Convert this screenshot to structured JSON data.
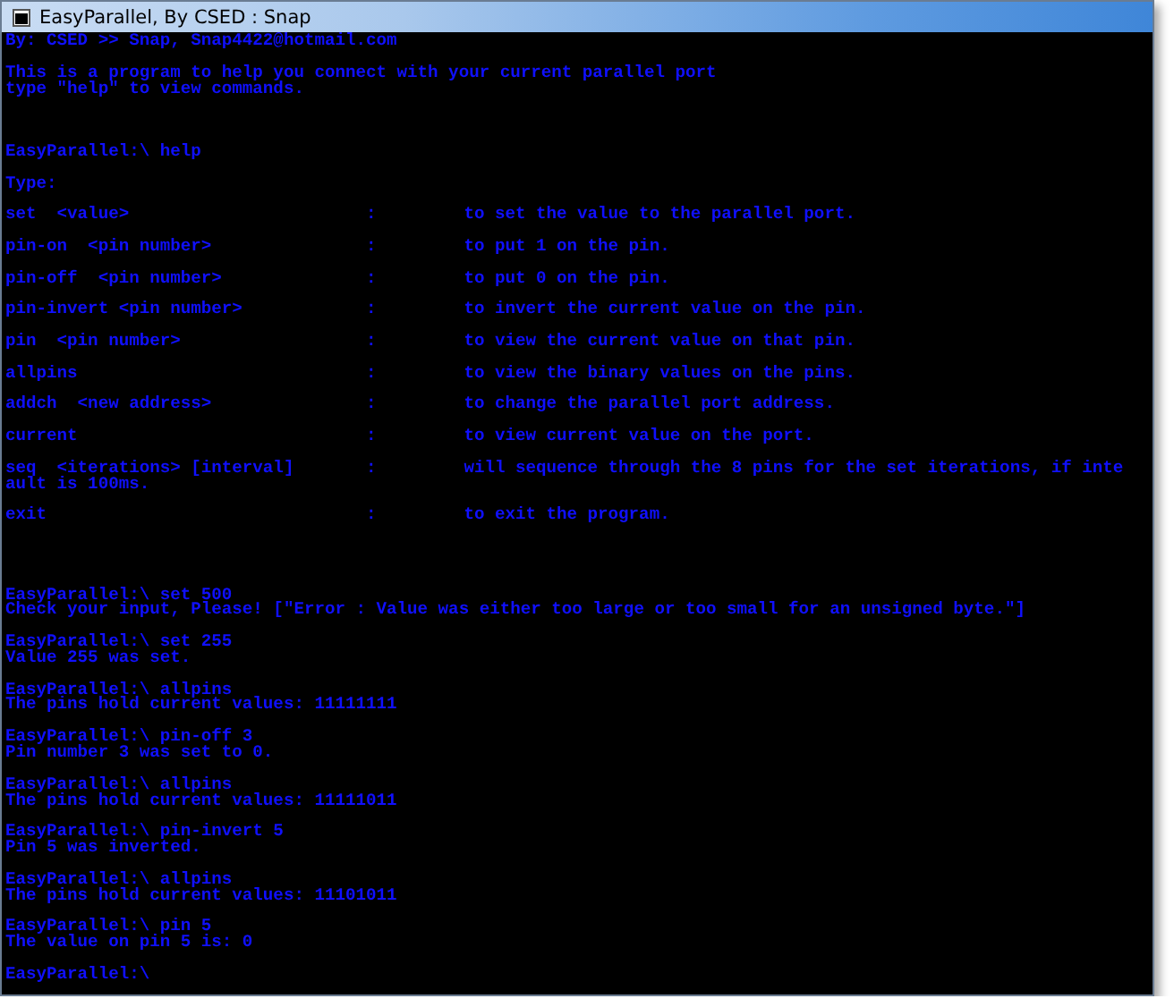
{
  "window": {
    "title": "EasyParallel, By CSED : Snap"
  },
  "console": [
    {
      "kind": "text",
      "text": "By: CSED >> Snap, Snap4422@hotmail.com"
    },
    {
      "kind": "gap"
    },
    {
      "kind": "text",
      "text": "This is a program to help you connect with your current parallel port"
    },
    {
      "kind": "text",
      "text": "type \"help\" to view commands."
    },
    {
      "kind": "gap"
    },
    {
      "kind": "gap"
    },
    {
      "kind": "gap"
    },
    {
      "kind": "text",
      "text": "EasyParallel:\\ help"
    },
    {
      "kind": "gap"
    },
    {
      "kind": "text",
      "text": "Type:"
    },
    {
      "kind": "gap"
    },
    {
      "kind": "help",
      "command": "set  <value>",
      "separator": ":",
      "description": "to set the value to the parallel port."
    },
    {
      "kind": "gap"
    },
    {
      "kind": "help",
      "command": "pin-on  <pin number>",
      "separator": ":",
      "description": "to put 1 on the pin."
    },
    {
      "kind": "gap"
    },
    {
      "kind": "help",
      "command": "pin-off  <pin number>",
      "separator": ":",
      "description": "to put 0 on the pin."
    },
    {
      "kind": "gap"
    },
    {
      "kind": "help",
      "command": "pin-invert <pin number>",
      "separator": ":",
      "description": "to invert the current value on the pin."
    },
    {
      "kind": "gap"
    },
    {
      "kind": "help",
      "command": "pin  <pin number>",
      "separator": ":",
      "description": "to view the current value on that pin."
    },
    {
      "kind": "gap"
    },
    {
      "kind": "help",
      "command": "allpins",
      "separator": ":",
      "description": "to view the binary values on the pins."
    },
    {
      "kind": "gap"
    },
    {
      "kind": "help",
      "command": "addch  <new address>",
      "separator": ":",
      "description": "to change the parallel port address."
    },
    {
      "kind": "gap"
    },
    {
      "kind": "help",
      "command": "current",
      "separator": ":",
      "description": "to view current value on the port."
    },
    {
      "kind": "gap"
    },
    {
      "kind": "help",
      "command": "seq  <iterations> [interval]",
      "separator": ":",
      "description": "will sequence through the 8 pins for the set iterations, if inte"
    },
    {
      "kind": "text",
      "text": "ault is 100ms."
    },
    {
      "kind": "gap"
    },
    {
      "kind": "help",
      "command": "exit",
      "separator": ":",
      "description": "to exit the program."
    },
    {
      "kind": "gap"
    },
    {
      "kind": "gap"
    },
    {
      "kind": "gap"
    },
    {
      "kind": "gap"
    },
    {
      "kind": "text",
      "text": "EasyParallel:\\ set 500"
    },
    {
      "kind": "text",
      "text": "Check your input, Please! [\"Error : Value was either too large or too small for an unsigned byte.\"]"
    },
    {
      "kind": "gap"
    },
    {
      "kind": "text",
      "text": "EasyParallel:\\ set 255"
    },
    {
      "kind": "text",
      "text": "Value 255 was set."
    },
    {
      "kind": "gap"
    },
    {
      "kind": "text",
      "text": "EasyParallel:\\ allpins"
    },
    {
      "kind": "text",
      "text": "The pins hold current values: 11111111"
    },
    {
      "kind": "gap"
    },
    {
      "kind": "text",
      "text": "EasyParallel:\\ pin-off 3"
    },
    {
      "kind": "text",
      "text": "Pin number 3 was set to 0."
    },
    {
      "kind": "gap"
    },
    {
      "kind": "text",
      "text": "EasyParallel:\\ allpins"
    },
    {
      "kind": "text",
      "text": "The pins hold current values: 11111011"
    },
    {
      "kind": "gap"
    },
    {
      "kind": "text",
      "text": "EasyParallel:\\ pin-invert 5"
    },
    {
      "kind": "text",
      "text": "Pin 5 was inverted."
    },
    {
      "kind": "gap"
    },
    {
      "kind": "text",
      "text": "EasyParallel:\\ allpins"
    },
    {
      "kind": "text",
      "text": "The pins hold current values: 11101011"
    },
    {
      "kind": "gap"
    },
    {
      "kind": "text",
      "text": "EasyParallel:\\ pin 5"
    },
    {
      "kind": "text",
      "text": "The value on pin 5 is: 0"
    },
    {
      "kind": "gap"
    },
    {
      "kind": "text",
      "text": "EasyParallel:\\"
    }
  ]
}
